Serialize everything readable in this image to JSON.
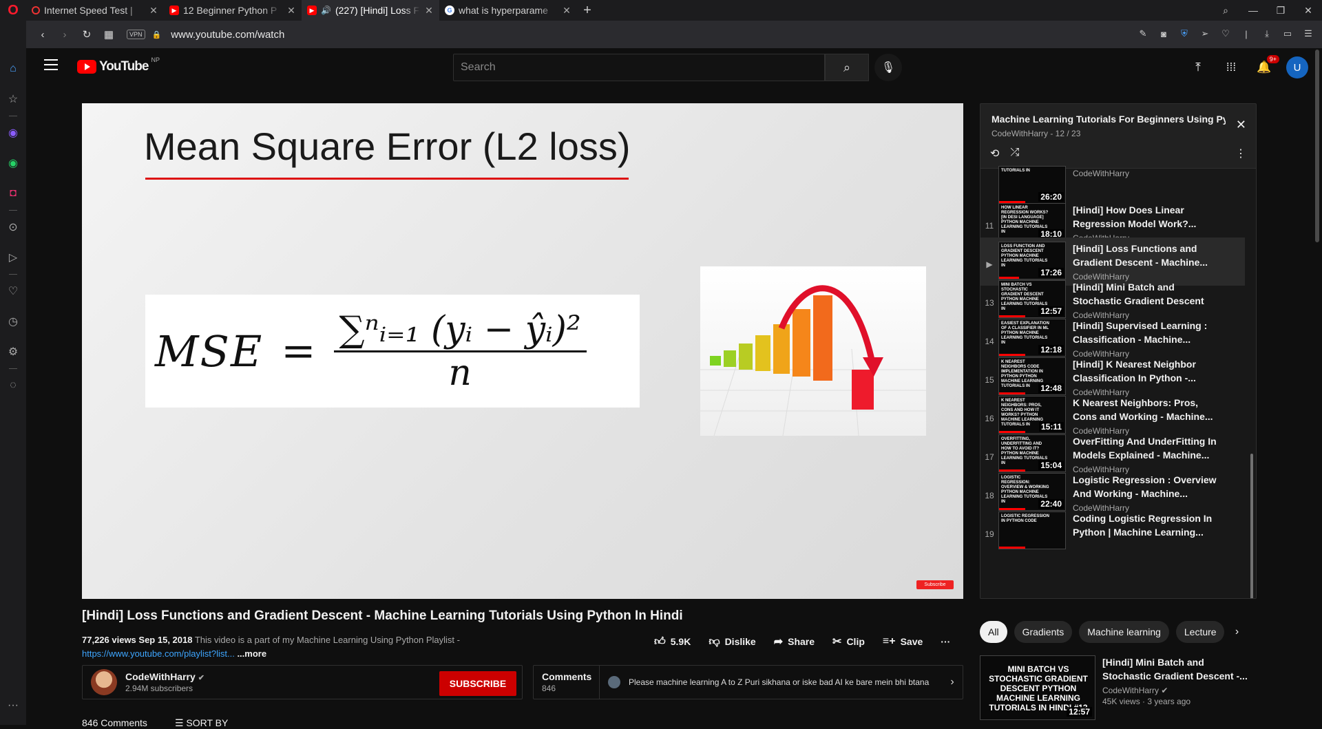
{
  "browser": {
    "tabs": [
      {
        "title": "Internet Speed Test |",
        "favicon": "speedtest-icon"
      },
      {
        "title": "12 Beginner Python P",
        "favicon": "youtube-icon"
      },
      {
        "title": "(227) [Hindi] Loss F",
        "favicon": "youtube-icon"
      },
      {
        "title": "what is hyperparame",
        "favicon": "google-icon"
      }
    ],
    "active_tab": 2,
    "url": "www.youtube.com/watch",
    "vpn_label": "VPN"
  },
  "youtube": {
    "logo_text": "YouTube",
    "region": "NP",
    "search_placeholder": "Search",
    "notification_badge": "9+",
    "avatar_letter": "U"
  },
  "slide": {
    "title": "Mean Square Error (L2 loss)",
    "formula_lhs": "MSE",
    "formula_eq": "=",
    "formula_num": "∑ⁿᵢ₌₁ (yᵢ − ŷᵢ)²",
    "formula_den": "n",
    "subscribe_mark": "Subscribe"
  },
  "video": {
    "title": "[Hindi] Loss Functions and Gradient Descent - Machine Learning Tutorials Using Python In Hindi",
    "views_date": "77,226 views  Sep 15, 2018",
    "description": "This video is a part of my Machine Learning Using Python Playlist -",
    "link": "https://www.youtube.com/playlist?list...",
    "more": "...more",
    "likes": "5.9K",
    "dislike": "Dislike",
    "share": "Share",
    "clip": "Clip",
    "save": "Save"
  },
  "channel": {
    "name": "CodeWithHarry",
    "subscribers": "2.94M subscribers",
    "subscribe": "SUBSCRIBE"
  },
  "comments": {
    "label": "Comments",
    "count": "846",
    "preview": "Please machine learning A to Z Puri sikhana or iske bad AI ke bare mein bhi btana",
    "header_count": "846 Comments",
    "sort": "SORT BY"
  },
  "playlist": {
    "title": "Machine Learning Tutorials For Beginners Using Py...",
    "subtitle": "CodeWithHarry - 12 / 23",
    "items": [
      {
        "idx": "",
        "thumb": "Tutorials in",
        "dur": "26:20",
        "title": "",
        "channel": "CodeWithHarry",
        "current": false
      },
      {
        "idx": "11",
        "thumb": "How linear regression works? [In desi language] Python machine learning tutorials in",
        "dur": "18:10",
        "title": "[Hindi] How Does Linear Regression Model Work?...",
        "channel": "CodeWithHarry",
        "current": false
      },
      {
        "idx": "▶",
        "thumb": "Loss function and gradient descent Python machine learning tutorials in",
        "dur": "17:26",
        "title": "[Hindi] Loss Functions and Gradient Descent - Machine...",
        "channel": "CodeWithHarry",
        "current": true
      },
      {
        "idx": "13",
        "thumb": "Mini batch vs stochastic gradient descent Python machine learning tutorials in",
        "dur": "12:57",
        "title": "[Hindi] Mini Batch and Stochastic Gradient Descent -...",
        "channel": "CodeWithHarry",
        "current": false
      },
      {
        "idx": "14",
        "thumb": "Easiest explanation of a classifier in ML Python machine learning tutorials in",
        "dur": "12:18",
        "title": "[Hindi] Supervised Learning : Classification - Machine...",
        "channel": "CodeWithHarry",
        "current": false
      },
      {
        "idx": "15",
        "thumb": "K nearest neighbors code implementation in Python Python machine learning tutorials in",
        "dur": "12:48",
        "title": "[Hindi] K Nearest Neighbor Classification In Python -...",
        "channel": "CodeWithHarry",
        "current": false
      },
      {
        "idx": "16",
        "thumb": "K nearest neighbors: pros, cons and how it works? Python machine learning tutorials in",
        "dur": "15:11",
        "title": "K Nearest Neighbors: Pros, Cons and Working - Machine...",
        "channel": "CodeWithHarry",
        "current": false
      },
      {
        "idx": "17",
        "thumb": "Overfitting, underfitting and how to avoid it? Python machine learning tutorials in",
        "dur": "15:04",
        "title": "OverFitting And UnderFitting In Models Explained - Machine...",
        "channel": "CodeWithHarry",
        "current": false
      },
      {
        "idx": "18",
        "thumb": "Logistic regression: overview & working Python machine learning tutorials in",
        "dur": "22:40",
        "title": "Logistic Regression : Overview And Working - Machine...",
        "channel": "CodeWithHarry",
        "current": false
      },
      {
        "idx": "19",
        "thumb": "Logistic regression in python code",
        "dur": "",
        "title": "Coding Logistic Regression In Python | Machine Learning...",
        "channel": "",
        "current": false
      }
    ]
  },
  "chips": [
    "All",
    "Gradients",
    "Machine learning",
    "Lecture"
  ],
  "recommended": {
    "thumb": "Mini batch vs stochastic gradient descent Python machine learning tutorials in Hindi #13",
    "dur": "12:57",
    "title": "[Hindi] Mini Batch and Stochastic Gradient Descent -...",
    "channel": "CodeWithHarry",
    "meta": "45K views · 3 years ago"
  },
  "colors": {
    "accent": "#ff0000",
    "subscribe": "#cc0000",
    "link": "#3ea6ff"
  }
}
